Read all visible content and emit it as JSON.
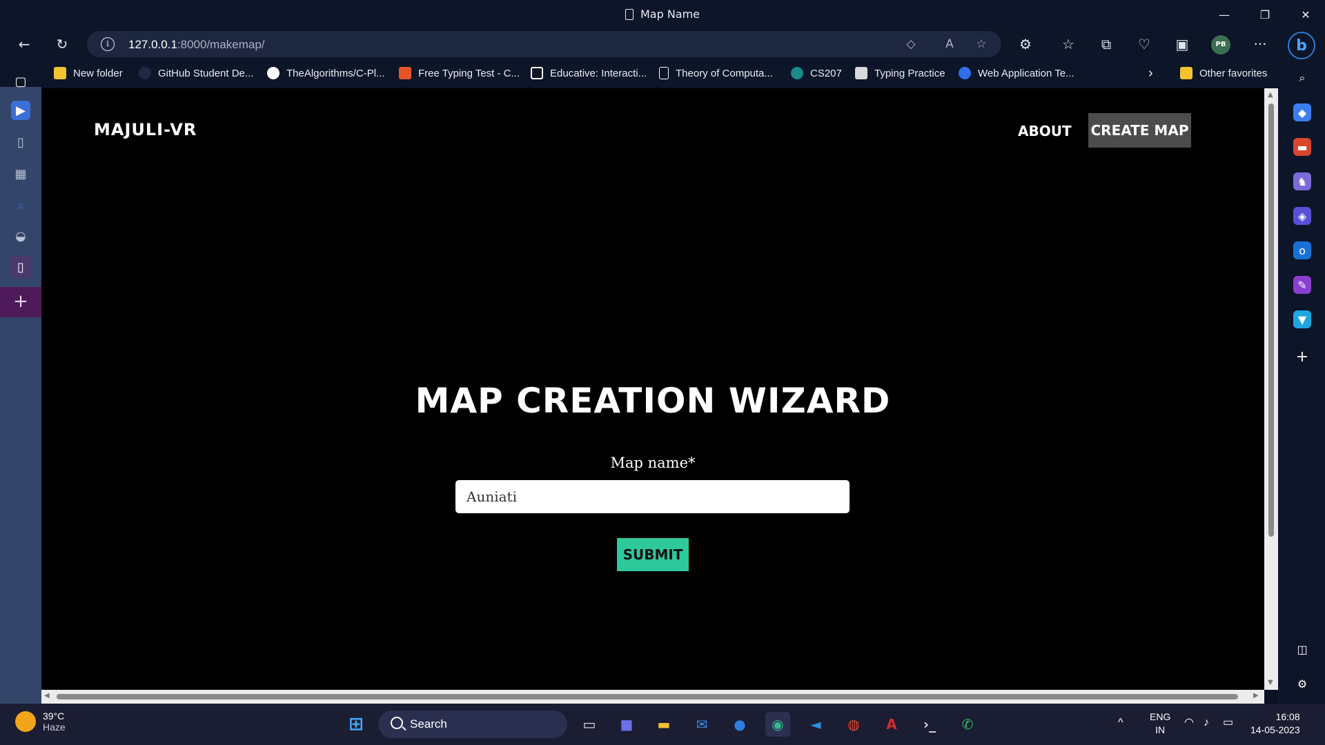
{
  "window": {
    "title": "Map Name",
    "minimize_glyph": "—",
    "restore_glyph": "❐",
    "close_glyph": "✕"
  },
  "toolbar": {
    "back_glyph": "←",
    "refresh_glyph": "↻",
    "url_host": "127.0.0.1",
    "url_rest": ":8000/makemap/",
    "more_glyph": "···",
    "avatar": "PB"
  },
  "favorites": [
    {
      "label": "New folder",
      "icon": "folder-icon"
    },
    {
      "label": "GitHub Student De...",
      "icon": "github-icon"
    },
    {
      "label": "TheAlgorithms/C-Pl...",
      "icon": "github-icon"
    },
    {
      "label": "Free Typing Test - C...",
      "icon": "typing-test-icon"
    },
    {
      "label": "Educative: Interacti...",
      "icon": "educative-icon"
    },
    {
      "label": "Theory of Computa...",
      "icon": "page-icon"
    },
    {
      "label": "CS207",
      "icon": "sharepoint-icon"
    },
    {
      "label": "Typing Practice",
      "icon": "typing-practice-icon"
    },
    {
      "label": "Web Application Te...",
      "icon": "c-icon"
    },
    {
      "label": "Other favorites",
      "icon": "folder-icon"
    }
  ],
  "page": {
    "brand": "MAJULI-VR",
    "nav": {
      "about": "ABOUT",
      "create_map": "CREATE MAP"
    },
    "wizard_title": "MAP CREATION WIZARD",
    "field_label": "Map name*",
    "field_value": "Auniati",
    "submit_label": "SUBMIT"
  },
  "taskbar": {
    "weather_temp": "39°C",
    "weather_cond": "Haze",
    "search_label": "Search",
    "lang_top": "ENG",
    "lang_bottom": "IN",
    "time": "16:08",
    "date": "14-05-2023"
  },
  "colors": {
    "page_bg": "#000000",
    "submit_bg": "#2ec99a",
    "create_map_bg": "#4c4c4c",
    "left_sidebar_bg": "#34456a",
    "chrome_bg": "#0d1528"
  }
}
